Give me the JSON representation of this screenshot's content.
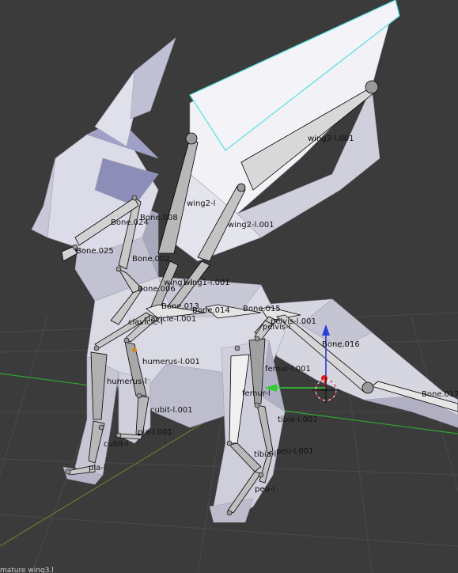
{
  "viewport": {
    "status_text": "mature wing3.l",
    "colors": {
      "background": "#3b3b3b",
      "grid": "#4a4a4a",
      "axis_x": "#2ea82e",
      "axis_y": "#6d8a2e",
      "mesh_light": "#dcdce6",
      "mesh_mid": "#b8b8c8",
      "mesh_dark": "#8c8ca0",
      "bone_fill": "#d2d2d2",
      "bone_edge": "#000000",
      "selected_bone_edge": "#55e0e0",
      "gizmo_z": "#2a3cd6",
      "gizmo_y": "#2ecc2e",
      "gizmo_origin": "#d82020"
    }
  },
  "bones": [
    {
      "label": "wing3-l",
      "selected": true
    },
    {
      "label": "wing3-l.001"
    },
    {
      "label": "wing2-l"
    },
    {
      "label": "wing2-l.001"
    },
    {
      "label": "Bone.008"
    },
    {
      "label": "Bone.024"
    },
    {
      "label": "Bone.025"
    },
    {
      "label": "Bone.002"
    },
    {
      "label": "Bone.006"
    },
    {
      "label": "wing1-l"
    },
    {
      "label": "wing1-l.001"
    },
    {
      "label": "Bone.013"
    },
    {
      "label": "Bone.014"
    },
    {
      "label": "Bone.015"
    },
    {
      "label": "clavicle-l"
    },
    {
      "label": "clavicle-l.001"
    },
    {
      "label": "pelvis-l.001"
    },
    {
      "label": "pelvis-l"
    },
    {
      "label": "Bone.016"
    },
    {
      "label": "humerus-l.001"
    },
    {
      "label": "humerus-l"
    },
    {
      "label": "femur-l.001"
    },
    {
      "label": "femur-l"
    },
    {
      "label": "Bone.017"
    },
    {
      "label": "cubit-l.001"
    },
    {
      "label": "cubit-l"
    },
    {
      "label": "tibia-l.001"
    },
    {
      "label": "tibia-l"
    },
    {
      "label": "peu-l.001"
    },
    {
      "label": "peu-l"
    },
    {
      "label": "pia-l.001"
    },
    {
      "label": "pia-l"
    }
  ]
}
